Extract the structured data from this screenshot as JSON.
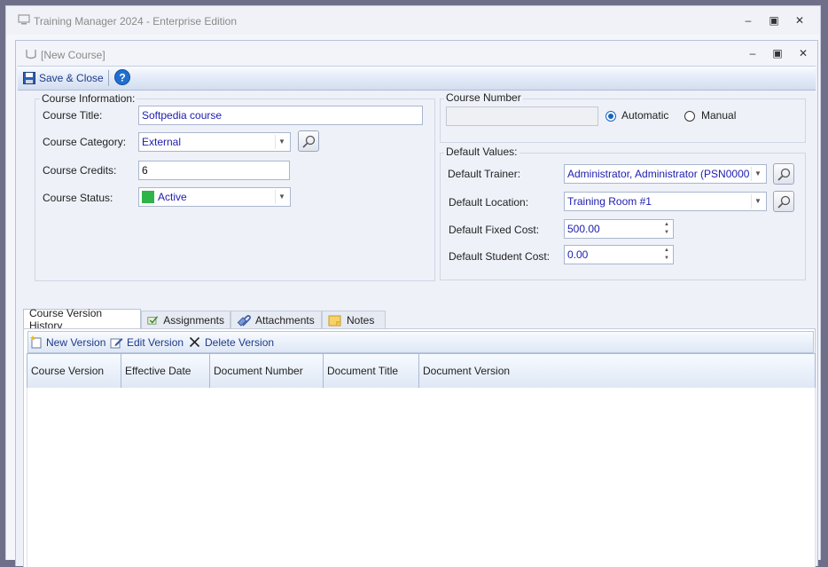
{
  "app": {
    "title": "Training Manager 2024 - Enterprise Edition",
    "controls": {
      "minimize": "–",
      "maximize": "▣",
      "close": "✕"
    }
  },
  "child": {
    "title": "[New Course]",
    "controls": {
      "minimize": "–",
      "maximize": "▣",
      "close": "✕"
    }
  },
  "toolbar": {
    "save_close_label": "Save & Close",
    "help_icon": "?"
  },
  "course_info": {
    "legend": "Course Information:",
    "title_label": "Course Title:",
    "title_value": "Softpedia course",
    "category_label": "Course Category:",
    "category_value": "External",
    "credits_label": "Course Credits:",
    "credits_value": "6",
    "status_label": "Course Status:",
    "status_value": "Active",
    "status_color": "#2fb44a"
  },
  "course_number": {
    "legend": "Course Number",
    "value": "",
    "automatic_label": "Automatic",
    "manual_label": "Manual",
    "selected": "Automatic"
  },
  "defaults": {
    "legend": "Default Values:",
    "trainer_label": "Default Trainer:",
    "trainer_value": "Administrator, Administrator (PSN0000",
    "location_label": "Default Location:",
    "location_value": "Training Room #1",
    "fixed_cost_label": "Default Fixed Cost:",
    "fixed_cost_value": "500.00",
    "student_cost_label": "Default Student Cost:",
    "student_cost_value": "0.00"
  },
  "tabs": [
    {
      "label": "Course Version History",
      "active": true
    },
    {
      "label": "Assignments",
      "active": false
    },
    {
      "label": "Attachments",
      "active": false
    },
    {
      "label": "Notes",
      "active": false
    }
  ],
  "version_toolbar": {
    "new_label": "New Version",
    "edit_label": "Edit Version",
    "delete_label": "Delete Version"
  },
  "grid": {
    "columns": [
      "Course Version",
      "Effective Date",
      "Document Number",
      "Document Title",
      "Document Version"
    ],
    "rows": []
  },
  "colors": {
    "accent": "#1565c0",
    "link_text": "#1e3a8a",
    "field_text": "#1c1cb0"
  }
}
